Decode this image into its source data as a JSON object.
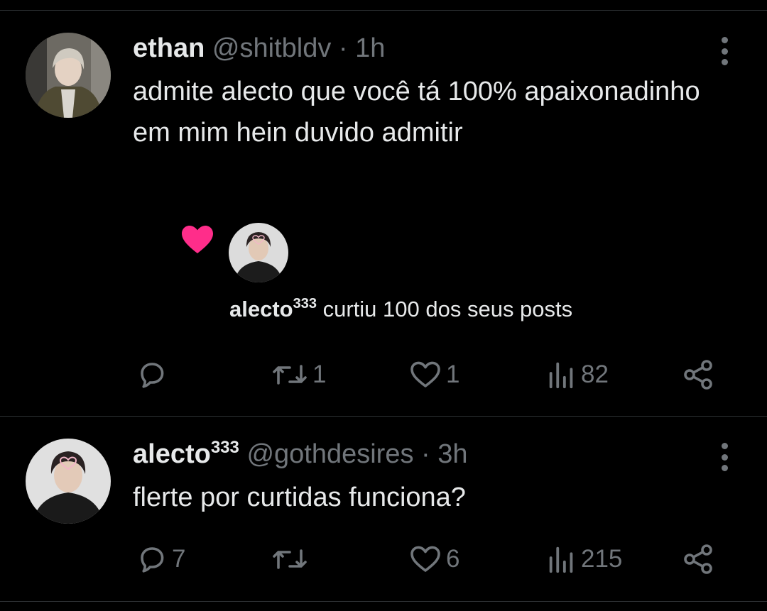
{
  "posts": [
    {
      "display_name": "ethan",
      "display_name_sup": "",
      "handle": "@shitbldv",
      "separator": "·",
      "time": "1h",
      "text": "admite alecto que você tá 100% apaixonadinho em mim hein duvido admitir",
      "embedded_notification": {
        "user": "alecto",
        "user_sup": "333",
        "message": "curtiu 100 dos seus posts",
        "heart_color": "#ff2d8a"
      },
      "stats": {
        "replies": "",
        "reposts": "1",
        "likes": "1",
        "views": "82"
      }
    },
    {
      "display_name": "alecto",
      "display_name_sup": "333",
      "handle": "@gothdesires",
      "separator": "·",
      "time": "3h",
      "text": "flerte por curtidas funciona?",
      "stats": {
        "replies": "7",
        "reposts": "",
        "likes": "6",
        "views": "215"
      }
    }
  ],
  "icons": {
    "reply": "reply-icon",
    "repost": "repost-icon",
    "like": "heart-icon",
    "views": "views-icon",
    "share": "share-icon",
    "more": "more-options-icon"
  },
  "colors": {
    "background": "#000000",
    "text": "#e7e9ea",
    "muted": "#71767b",
    "divider": "#2f3336"
  }
}
